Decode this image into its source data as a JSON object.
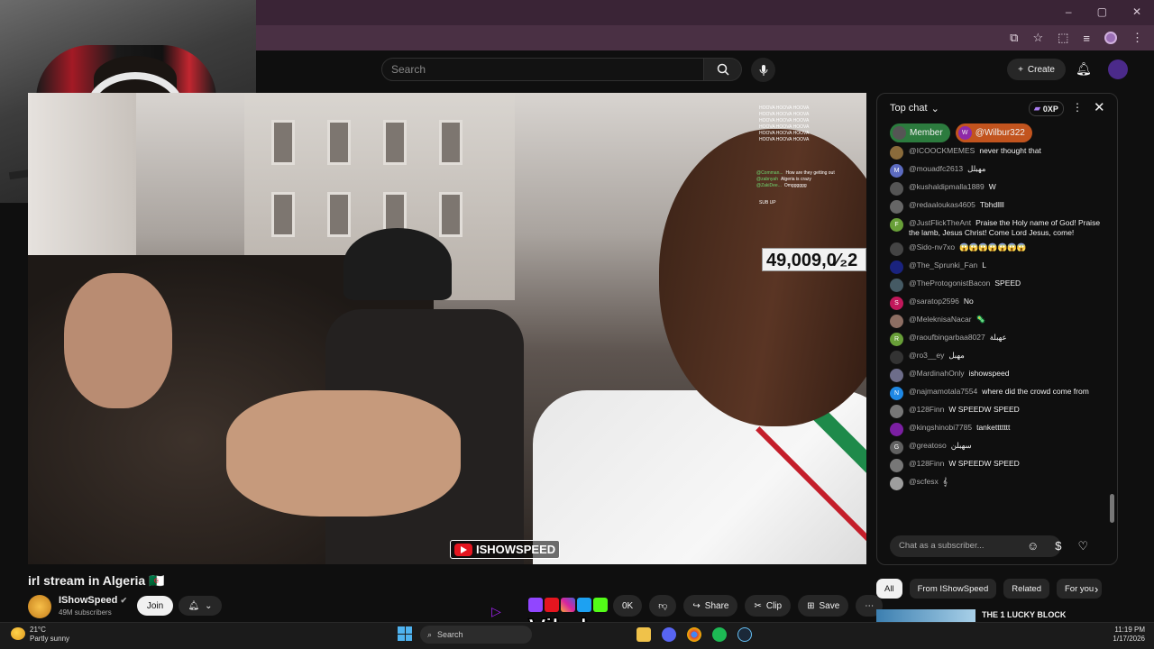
{
  "browser": {
    "window_controls": [
      "–",
      "▢",
      "✕"
    ]
  },
  "header": {
    "search_placeholder": "Search",
    "create_label": "Create"
  },
  "video": {
    "counter": "49,009,0⁄₂2",
    "badge": "ISHOWSPEED",
    "overlay_chat": [
      {
        "name": "",
        "text": "HOOVA HOOVA HOOVA"
      },
      {
        "name": "",
        "text": "HOOVA HOOVA HOOVA"
      },
      {
        "name": "",
        "text": "HOOVA HOOVA HOOVA"
      },
      {
        "name": "",
        "text": "HOOVA HOOVA HOOVA"
      },
      {
        "name": "",
        "text": "HOOVA HOOVA HOOVA"
      },
      {
        "name": "",
        "text": "HOOVA HOOVA HOOVA"
      },
      {
        "name": "@Comman...",
        "text": "How are they getting out"
      },
      {
        "name": "@zabnyah",
        "text": "Algeria is crazy"
      },
      {
        "name": "@ZakiDee...",
        "text": "Omgggggg"
      },
      {
        "name": "",
        "text": "SUB UP"
      }
    ]
  },
  "chat": {
    "header_label": "Top chat",
    "xp_label": "0XP",
    "pills": [
      {
        "label": "Member",
        "initial": ""
      },
      {
        "label": "@Wilbur322",
        "initial": "W"
      }
    ],
    "messages": [
      {
        "name": "@ICOOCKMEMES",
        "text": "never thought that",
        "initial": "",
        "color": "#8a6b3b"
      },
      {
        "name": "@mouadfc2613",
        "text": "مهبلل",
        "initial": "M",
        "color": "#5c6bc0"
      },
      {
        "name": "@kushaldipmalla1889",
        "text": "W",
        "initial": "",
        "color": "#555555"
      },
      {
        "name": "@redaaloukas4605",
        "text": "Tbhdllll",
        "initial": "",
        "color": "#666666"
      },
      {
        "name": "@JustFlickTheAnt",
        "text": "Praise the Holy name of God! Praise the lamb, Jesus Christ! Come Lord Jesus, come!",
        "initial": "F",
        "color": "#689f38"
      },
      {
        "name": "@Sido-nv7xo",
        "text": "😱😱😱😱😱😱😱",
        "initial": "",
        "color": "#444444"
      },
      {
        "name": "@The_Sprunki_Fan",
        "text": "L",
        "initial": "",
        "color": "#1a237e"
      },
      {
        "name": "@TheProtogonistBacon",
        "text": "SPEED",
        "initial": "",
        "color": "#455a64"
      },
      {
        "name": "@saratop2596",
        "text": "No",
        "initial": "S",
        "color": "#c2185b"
      },
      {
        "name": "@MeleknisaNacar",
        "text": "🦠",
        "initial": "",
        "color": "#8d6e63"
      },
      {
        "name": "@raoufbingarbaa8027",
        "text": "عهبلة",
        "initial": "R",
        "color": "#689f38"
      },
      {
        "name": "@ro3__ey",
        "text": "مهبل",
        "initial": "",
        "color": "#333333"
      },
      {
        "name": "@MardinahOnly",
        "text": "ishowspeed",
        "initial": "",
        "color": "#6d6d8a"
      },
      {
        "name": "@najmamotala7554",
        "text": "where did the crowd come from",
        "initial": "N",
        "color": "#1e88e5"
      },
      {
        "name": "@128Finn",
        "text": "W SPEEDW SPEED",
        "initial": "",
        "color": "#777777"
      },
      {
        "name": "@kingshinobi7785",
        "text": "tankettttttt",
        "initial": "",
        "color": "#7b1fa2"
      },
      {
        "name": "@greatoso",
        "text": "سهبلن",
        "initial": "G",
        "color": "#616161"
      },
      {
        "name": "@128Finn",
        "text": "W SPEEDW SPEED",
        "initial": "",
        "color": "#777777"
      },
      {
        "name": "@scfesx",
        "text": "𝄞",
        "initial": "",
        "color": "#9e9e9e"
      }
    ],
    "input_placeholder": "Chat as a subscriber..."
  },
  "below": {
    "title": "irl stream in Algeria 🇩🇿",
    "channel_name": "IShowSpeed",
    "subscribers": "49M subscribers",
    "join_label": "Join",
    "like_count": "0K",
    "share_label": "Share",
    "clip_label": "Clip",
    "save_label": "Save",
    "watermark": "Vibzlo"
  },
  "filters": {
    "chips": [
      "All",
      "From IShowSpeed",
      "Related",
      "For you"
    ]
  },
  "recommendation": {
    "title": "THE 1 LUCKY BLOCK"
  },
  "taskbar": {
    "temp": "21°C",
    "weather": "Partly sunny",
    "search_label": "Search",
    "time": "11:19 PM",
    "date": "1/17/2026"
  }
}
